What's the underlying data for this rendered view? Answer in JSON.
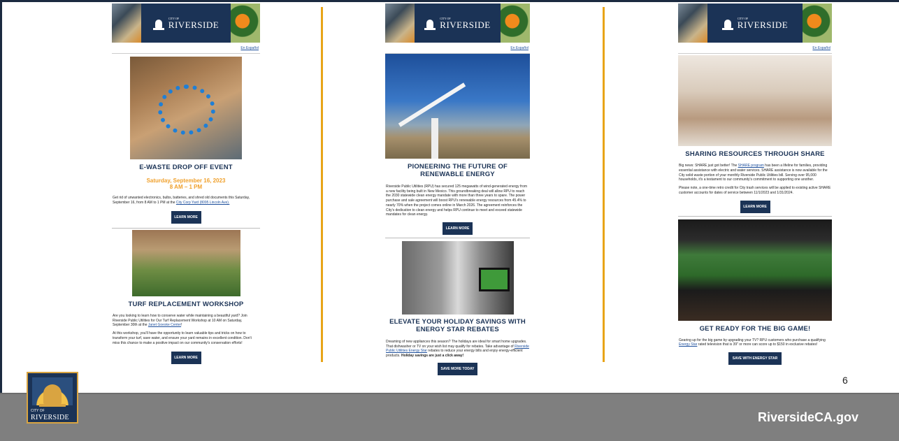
{
  "banner": {
    "city_of": "CITY OF",
    "city_name": "RIVERSIDE",
    "espanol": "En Español"
  },
  "col1": {
    "ewaste": {
      "title": "E-WASTE DROP OFF EVENT",
      "date": "Saturday, September 16, 2023",
      "time": "8 AM – 1 PM",
      "body_1": "Get rid of unwanted electronics, bulbs, batteries, and shred old documents this Saturday, September 16, from 8 AM to 1 PM at the ",
      "body_link": "City Corp Yard (8095 Lincoln Ave).",
      "button": "LEARN MORE"
    },
    "turf": {
      "title": "TURF REPLACEMENT WORKSHOP",
      "body_1a": "Are you looking to learn how to conserve water while maintaining a beautiful yard? Join Riverside Public Utilities for Our Turf Replacement Workshop at 10 AM on Saturday, September 30th at the ",
      "body_1_link": "Janet Goeske Center",
      "body_1b": "!",
      "body_2": "At this workshop, you'll have the opportunity to learn valuable tips and tricks on how to transform your turf, save water, and ensure your yard remains in excellent condition. Don't miss this chance to make a positive impact on our community's conservation efforts!",
      "button": "LEARN MORE"
    }
  },
  "col2": {
    "wind": {
      "title_1": "PIONEERING THE FUTURE OF",
      "title_2": "RENEWABLE ENERGY",
      "body": "Riverside Public Utilities (RPU) has secured 125 megawatts of wind-generated energy from a new facility being built in New Mexico. This groundbreaking deal will allow RPU to reach the 2030 statewide clean energy mandate with more than three years to spare. The power purchase and sale agreement will boost RPU's renewable energy resources from 45.4% to nearly 70% when the project comes online in March 2026. The agreement reinforces the City's dedication to clean energy and helps RPU continue to meet and exceed statewide mandates for clean energy.",
      "button": "LEARN MORE"
    },
    "appliance": {
      "title_1": "ELEVATE YOUR HOLIDAY SAVINGS WITH",
      "title_2": "ENERGY STAR REBATES",
      "body_1": "Dreaming of new appliances this season? The holidays are ideal for smart home upgrades. That dishwasher or TV on your wish list may qualify for rebates. Take advantage of ",
      "body_link": "Riverside Public Utilities Energy Star",
      "body_2": " rebates to reduce your energy bills and enjoy energy-efficient products. ",
      "body_bold": "Holiday savings are just a click away!",
      "button": "SAVE MORE TODAY"
    }
  },
  "col3": {
    "share": {
      "title": "SHARING RESOURCES THROUGH SHARE",
      "body_1a": "Big news: SHARE just got better! The ",
      "body_1_link": "SHARE program",
      "body_1b": " has been a lifeline for families, providing essential assistance with electric and water services. SHARE assistance is now available for the City solid waste portion of your monthly Riverside Public Utilities bill. Serving over 95,000 households, it's a testament to our community's commitment to supporting one another.",
      "body_2": "Please note, a one-time retro credit for City trash services will be applied to existing active SHARE customer accounts for dates of service between 11/1/2023 and 1/31/2024.",
      "button": "LEARN MORE"
    },
    "game": {
      "title": "GET READY FOR THE BIG GAME!",
      "body_1": "Gearing up for the big game by upgrading your TV? RPU customers who purchase a qualifying ",
      "body_link": "Energy Star",
      "body_2": " rated television that is 39\" or more can score up to $150 in exclusive rebates!",
      "button": "SAVE WITH ENERGY STAR"
    }
  },
  "page_number": "6",
  "footer": {
    "site": "RiversideCA.gov",
    "seal_city_of": "CITY OF",
    "seal_name": "RIVERSIDE"
  },
  "colors": {
    "navy": "#1b3356",
    "gold": "#e8a418",
    "footer": "#7f7f7f",
    "date_orange": "#f0a02b"
  }
}
